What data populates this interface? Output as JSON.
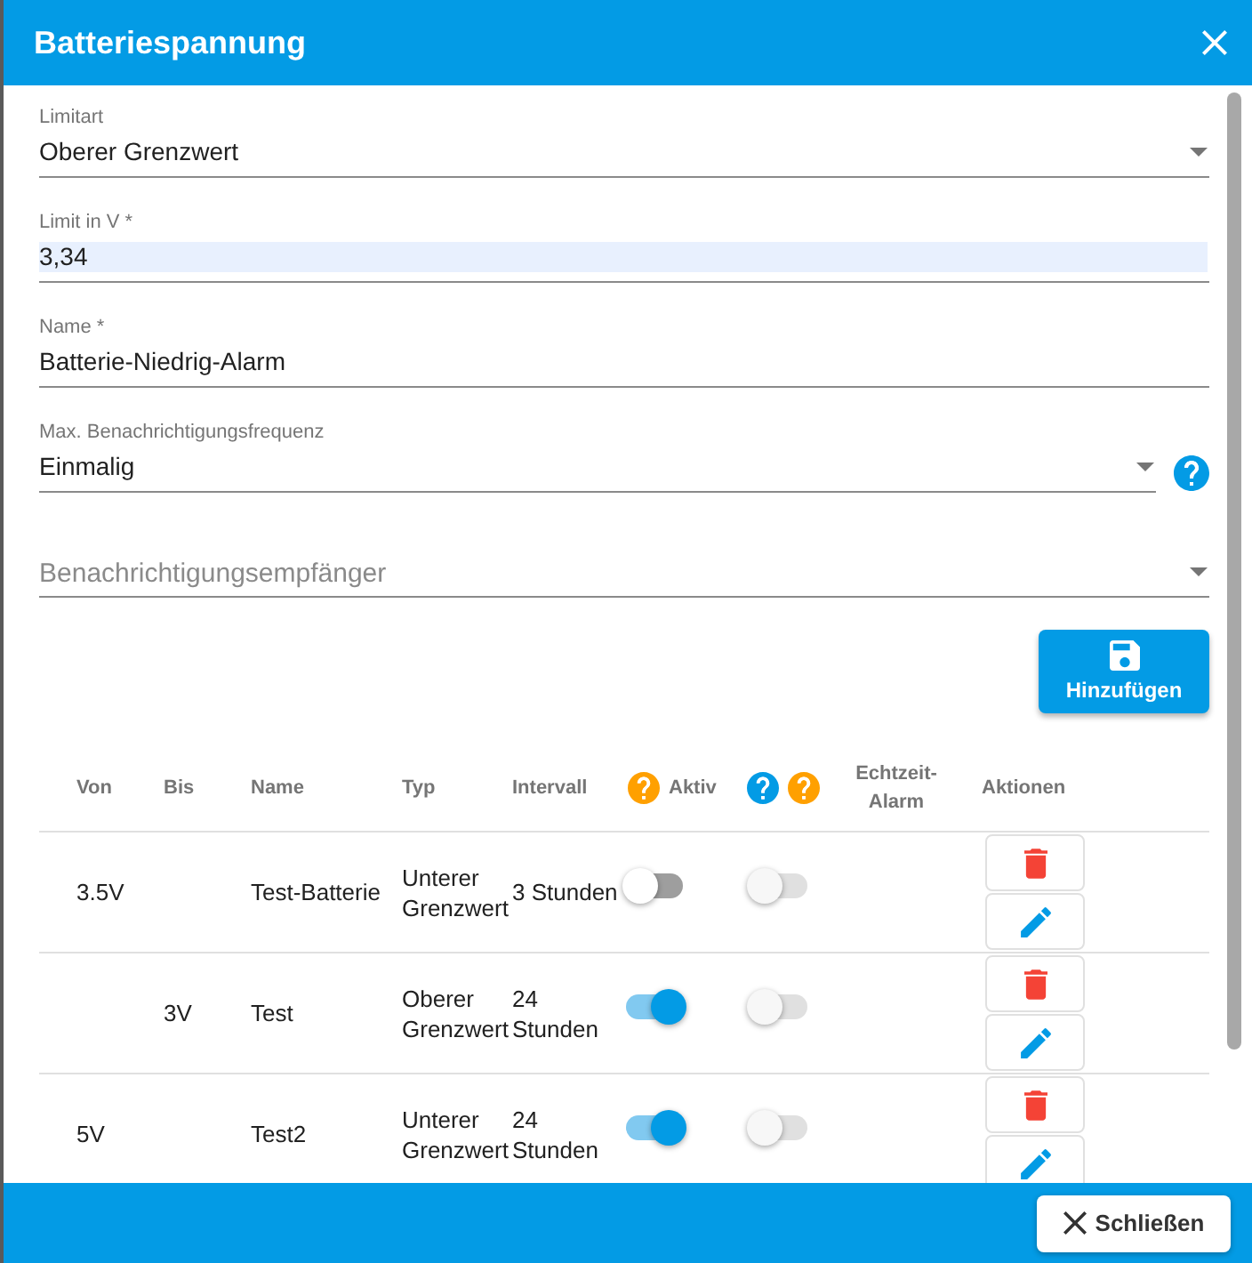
{
  "dialog": {
    "title": "Batteriespannung"
  },
  "form": {
    "fields": [
      {
        "kind": "select",
        "label": "Limitart",
        "value": "Oberer Grenzwert"
      },
      {
        "kind": "input",
        "label": "Limit in V *",
        "value": "3,34",
        "autofilled": true
      },
      {
        "kind": "input",
        "label": "Name *",
        "value": "Batterie-Niedrig-Alarm"
      },
      {
        "kind": "select",
        "label": "Max. Benachrichtigungsfrequenz",
        "value": "Einmalig",
        "help": true
      },
      {
        "kind": "select",
        "placeholder": "Benachrichtigungsempfänger"
      }
    ]
  },
  "add_button": {
    "label": "Hinzufügen"
  },
  "table": {
    "columns": [
      {
        "label": "Von"
      },
      {
        "label": "Bis"
      },
      {
        "label": "Name"
      },
      {
        "label": "Typ"
      },
      {
        "label": "Intervall"
      },
      {
        "label": "Aktiv",
        "help_icons": [
          {
            "color": "#ffa000"
          }
        ]
      },
      {
        "help_icons": [
          {
            "color": "#039be5"
          },
          {
            "color": "#ffa000"
          }
        ]
      },
      {
        "label": "Echtzeit-Alarm"
      },
      {
        "label": "Aktionen"
      }
    ],
    "rows": [
      {
        "von": "3.5V",
        "name": "Test-Batterie",
        "typ": "Unterer Grenzwert",
        "intervall": "3 Stunden",
        "toggles": [
          {
            "on": false,
            "disabled": false
          },
          {
            "on": false,
            "disabled": true
          }
        ]
      },
      {
        "bis": "3V",
        "name": "Test",
        "typ": "Oberer Grenzwert",
        "intervall": "24 Stunden",
        "toggles": [
          {
            "on": true,
            "disabled": false
          },
          {
            "on": false,
            "disabled": true
          }
        ]
      },
      {
        "von": "5V",
        "name": "Test2",
        "typ": "Unterer Grenzwert",
        "intervall": "24 Stunden",
        "toggles": [
          {
            "on": true,
            "disabled": false
          },
          {
            "on": false,
            "disabled": true
          }
        ]
      }
    ]
  },
  "footer": {
    "close_button": {
      "label": "Schließen"
    }
  }
}
